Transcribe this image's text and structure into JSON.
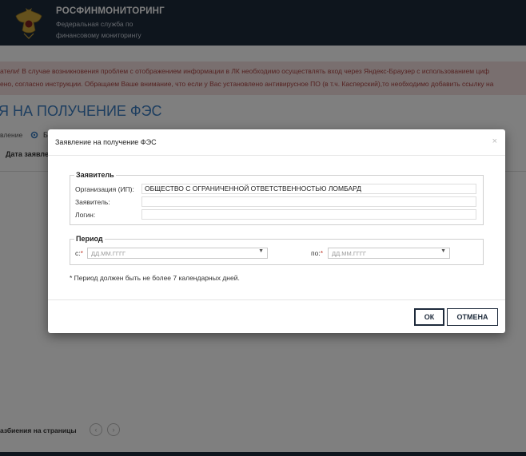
{
  "header": {
    "title": "РОСФИНМОНИТОРИНГ",
    "subtitle_line1": "Федеральная служба по",
    "subtitle_line2": "финансовому мониторингу"
  },
  "alert": {
    "line1": "атели! В случае возникновения проблем с отображением информации в ЛК необходимо осуществлять вход через Яндекс-Браузер с использованием циф",
    "line2": "ено, согласно инструкции. Обращаем Ваше внимание, что если у Вас установлено антивирусное ПО (в т.ч. Касперский),то необходимо добавить ссылку на"
  },
  "page": {
    "title": "Я НА ПОЛУЧЕНИЕ ФЭС",
    "breadcrumb_text": "вление",
    "breadcrumb_next": "Б",
    "column_header": "Дата заявле",
    "paging_label": "азбиения на страницы",
    "prev_glyph": "‹",
    "next_glyph": "›"
  },
  "modal": {
    "title": "Заявление на получение ФЭС",
    "close_glyph": "×",
    "applicant": {
      "legend": "Заявитель",
      "org_label": "Организация (ИП):",
      "org_value": "ОБЩЕСТВО С ОГРАНИЧЕННОЙ ОТВЕТСТВЕННОСТЬЮ ЛОМБАРД",
      "applicant_label": "Заявитель:",
      "applicant_value": "",
      "login_label": "Логин:",
      "login_value": ""
    },
    "period": {
      "legend": "Период",
      "from_label": "с:",
      "to_label": "по:",
      "required_mark": "*",
      "date_placeholder": "ДД.ММ.ГГГГ",
      "caret_glyph": "▼"
    },
    "note": "* Период должен быть не более 7 календарных дней.",
    "ok_label": "ОК",
    "cancel_label": "ОТМЕНА"
  },
  "colors": {
    "header_bg": "#1d2a3b",
    "title_blue": "#3a7cc1",
    "alert_bg": "#f2dede",
    "alert_text": "#a94442"
  }
}
